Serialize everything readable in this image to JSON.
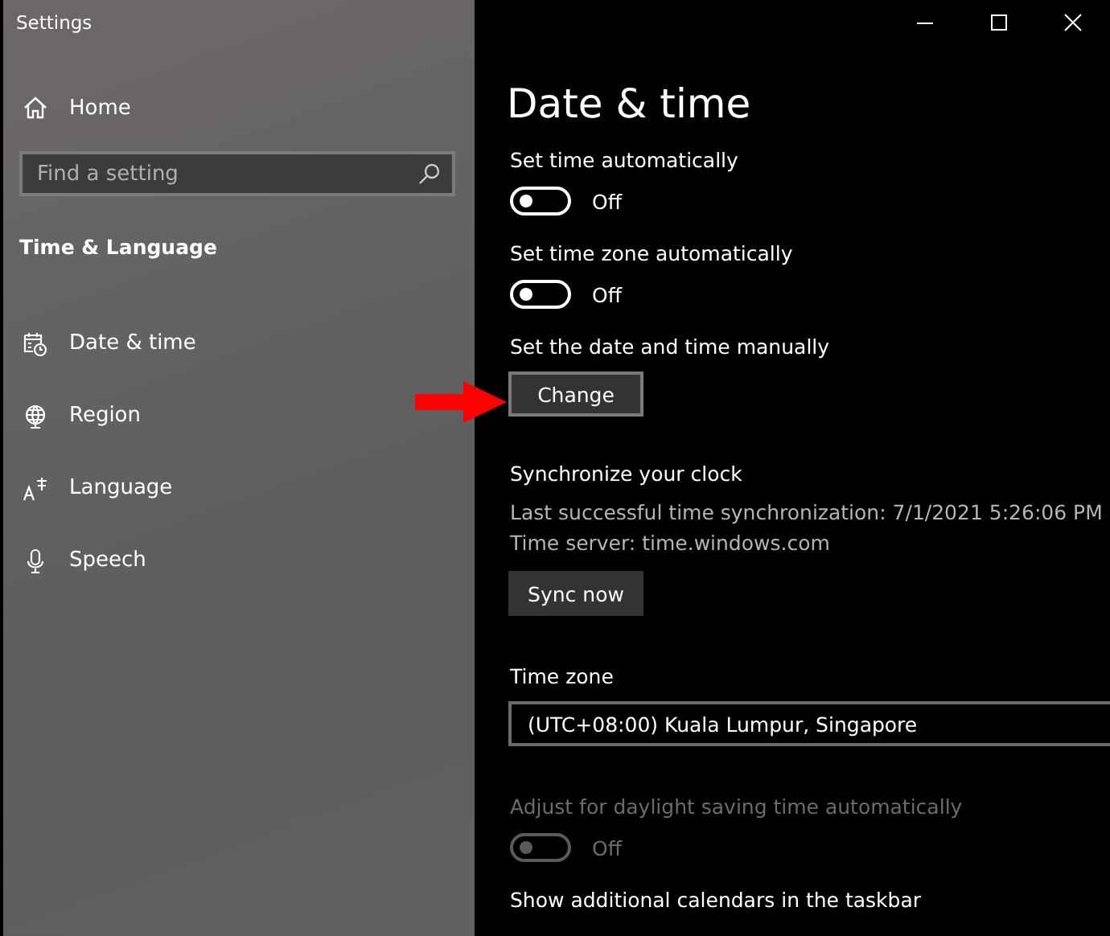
{
  "window": {
    "title": "Settings"
  },
  "sidebar": {
    "home": "Home",
    "search": {
      "placeholder": "Find a setting"
    },
    "section": "Time & Language",
    "items": [
      {
        "label": "Date & time"
      },
      {
        "label": "Region"
      },
      {
        "label": "Language"
      },
      {
        "label": "Speech"
      }
    ]
  },
  "content": {
    "heading": "Date & time",
    "sections": [
      {
        "kind": "toggle",
        "label": "Set time automatically",
        "on": false,
        "state_text": "Off",
        "disabled": false
      },
      {
        "kind": "toggle",
        "label": "Set time zone automatically",
        "on": false,
        "state_text": "Off",
        "disabled": false
      },
      {
        "kind": "button",
        "label": "Set the date and time manually",
        "button": "Change",
        "hovered": true,
        "pointed_at": true
      },
      {
        "kind": "sync",
        "label": "Synchronize your clock",
        "lines": [
          "Last successful time synchronization: 7/1/2021 5:26:06 PM",
          "Time server: time.windows.com"
        ],
        "button": "Sync now",
        "hovered": false
      },
      {
        "kind": "dropdown",
        "label": "Time zone",
        "value": "(UTC+08:00) Kuala Lumpur, Singapore"
      },
      {
        "kind": "toggle",
        "label": "Adjust for daylight saving time automatically",
        "on": false,
        "state_text": "Off",
        "disabled": true
      },
      {
        "kind": "label",
        "label": "Show additional calendars in the taskbar"
      }
    ]
  }
}
